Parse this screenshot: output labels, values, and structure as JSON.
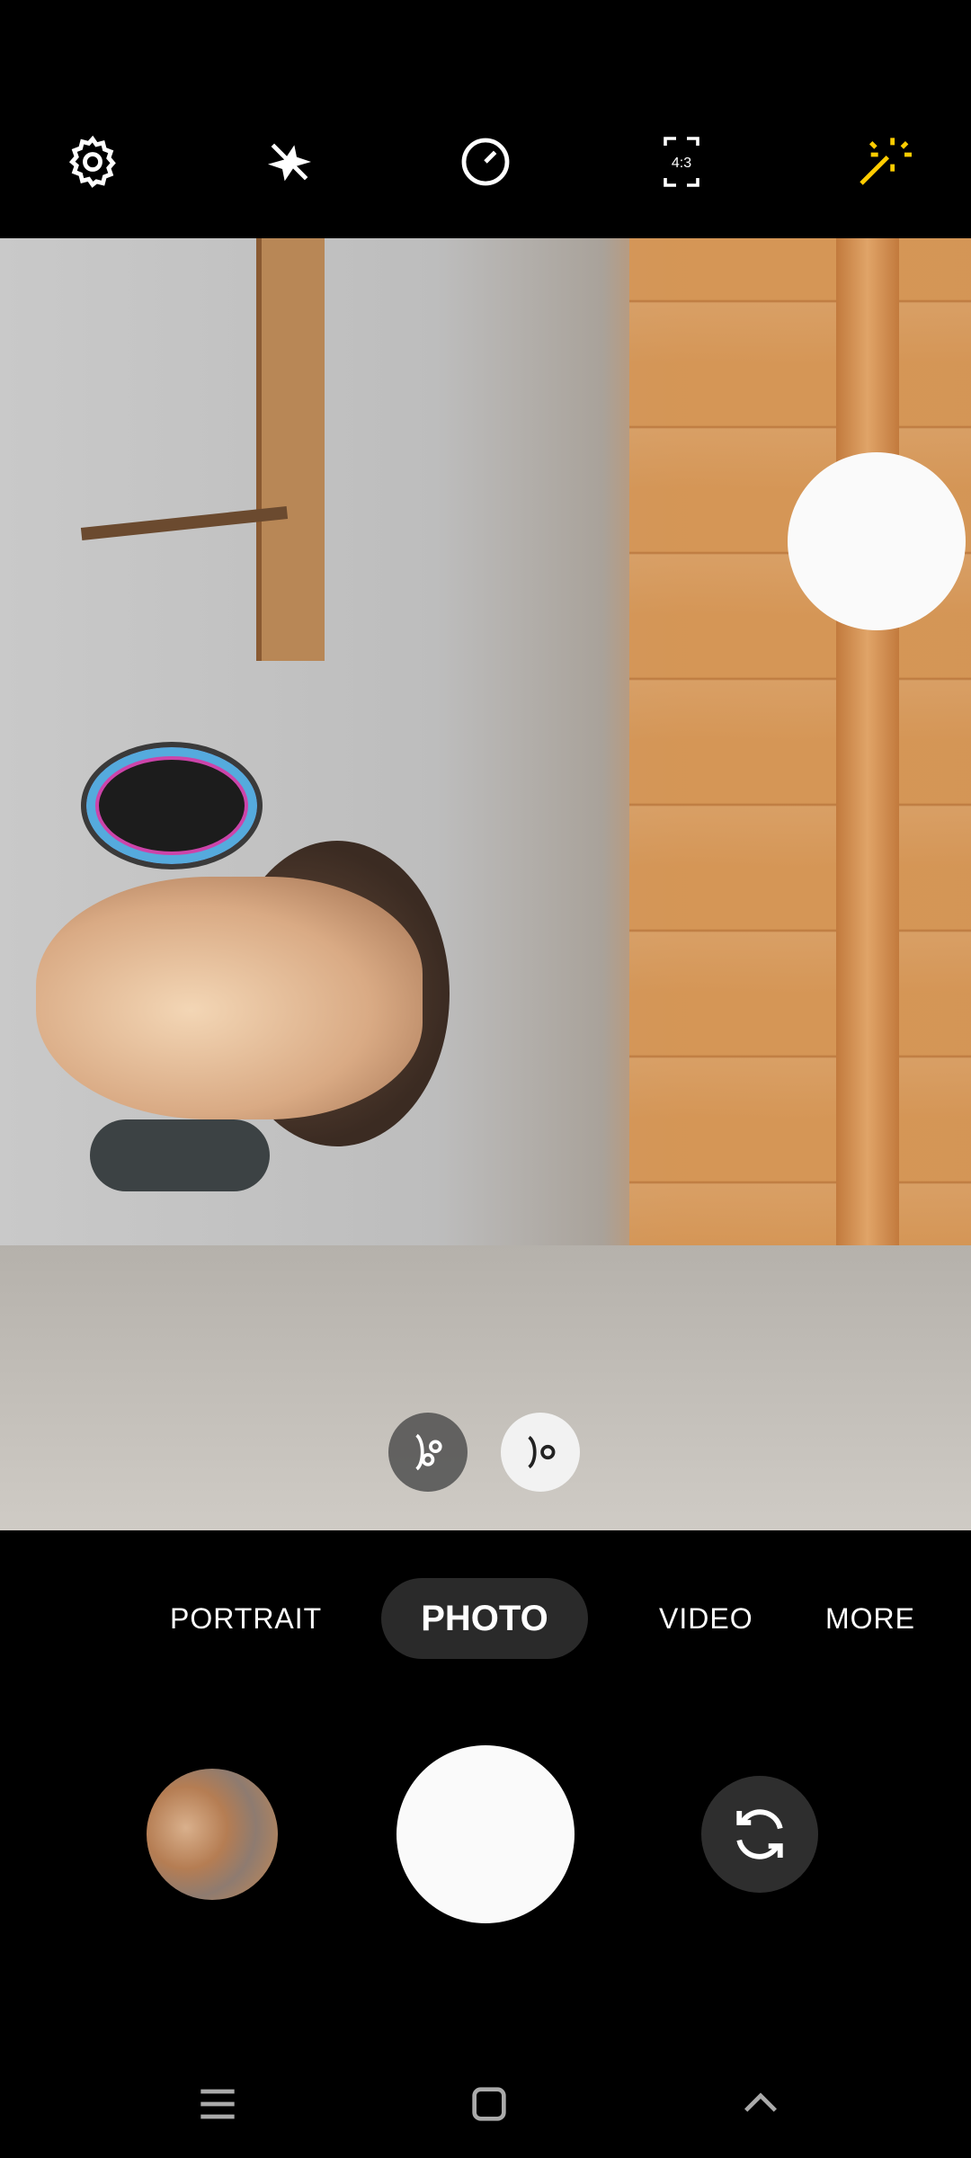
{
  "top_toolbar": {
    "icons": [
      "settings-icon",
      "flash-off-icon",
      "timer-icon",
      "aspect-ratio-icon",
      "filter-effects-icon"
    ],
    "aspect_ratio_label": "4:3",
    "accent_color": "#ffcc00"
  },
  "viewfinder": {
    "lens_options": [
      "multi-lens-icon",
      "single-lens-icon"
    ],
    "selected_lens": "single-lens-icon"
  },
  "modes": {
    "items": [
      "PORTRAIT",
      "PHOTO",
      "VIDEO",
      "MORE"
    ],
    "selected": "PHOTO"
  },
  "bottom_controls": {
    "gallery": "gallery-thumbnail",
    "shutter": "shutter-button",
    "switch": "switch-camera-icon"
  },
  "navbar": {
    "icons": [
      "recents-icon",
      "home-icon",
      "back-icon"
    ]
  }
}
